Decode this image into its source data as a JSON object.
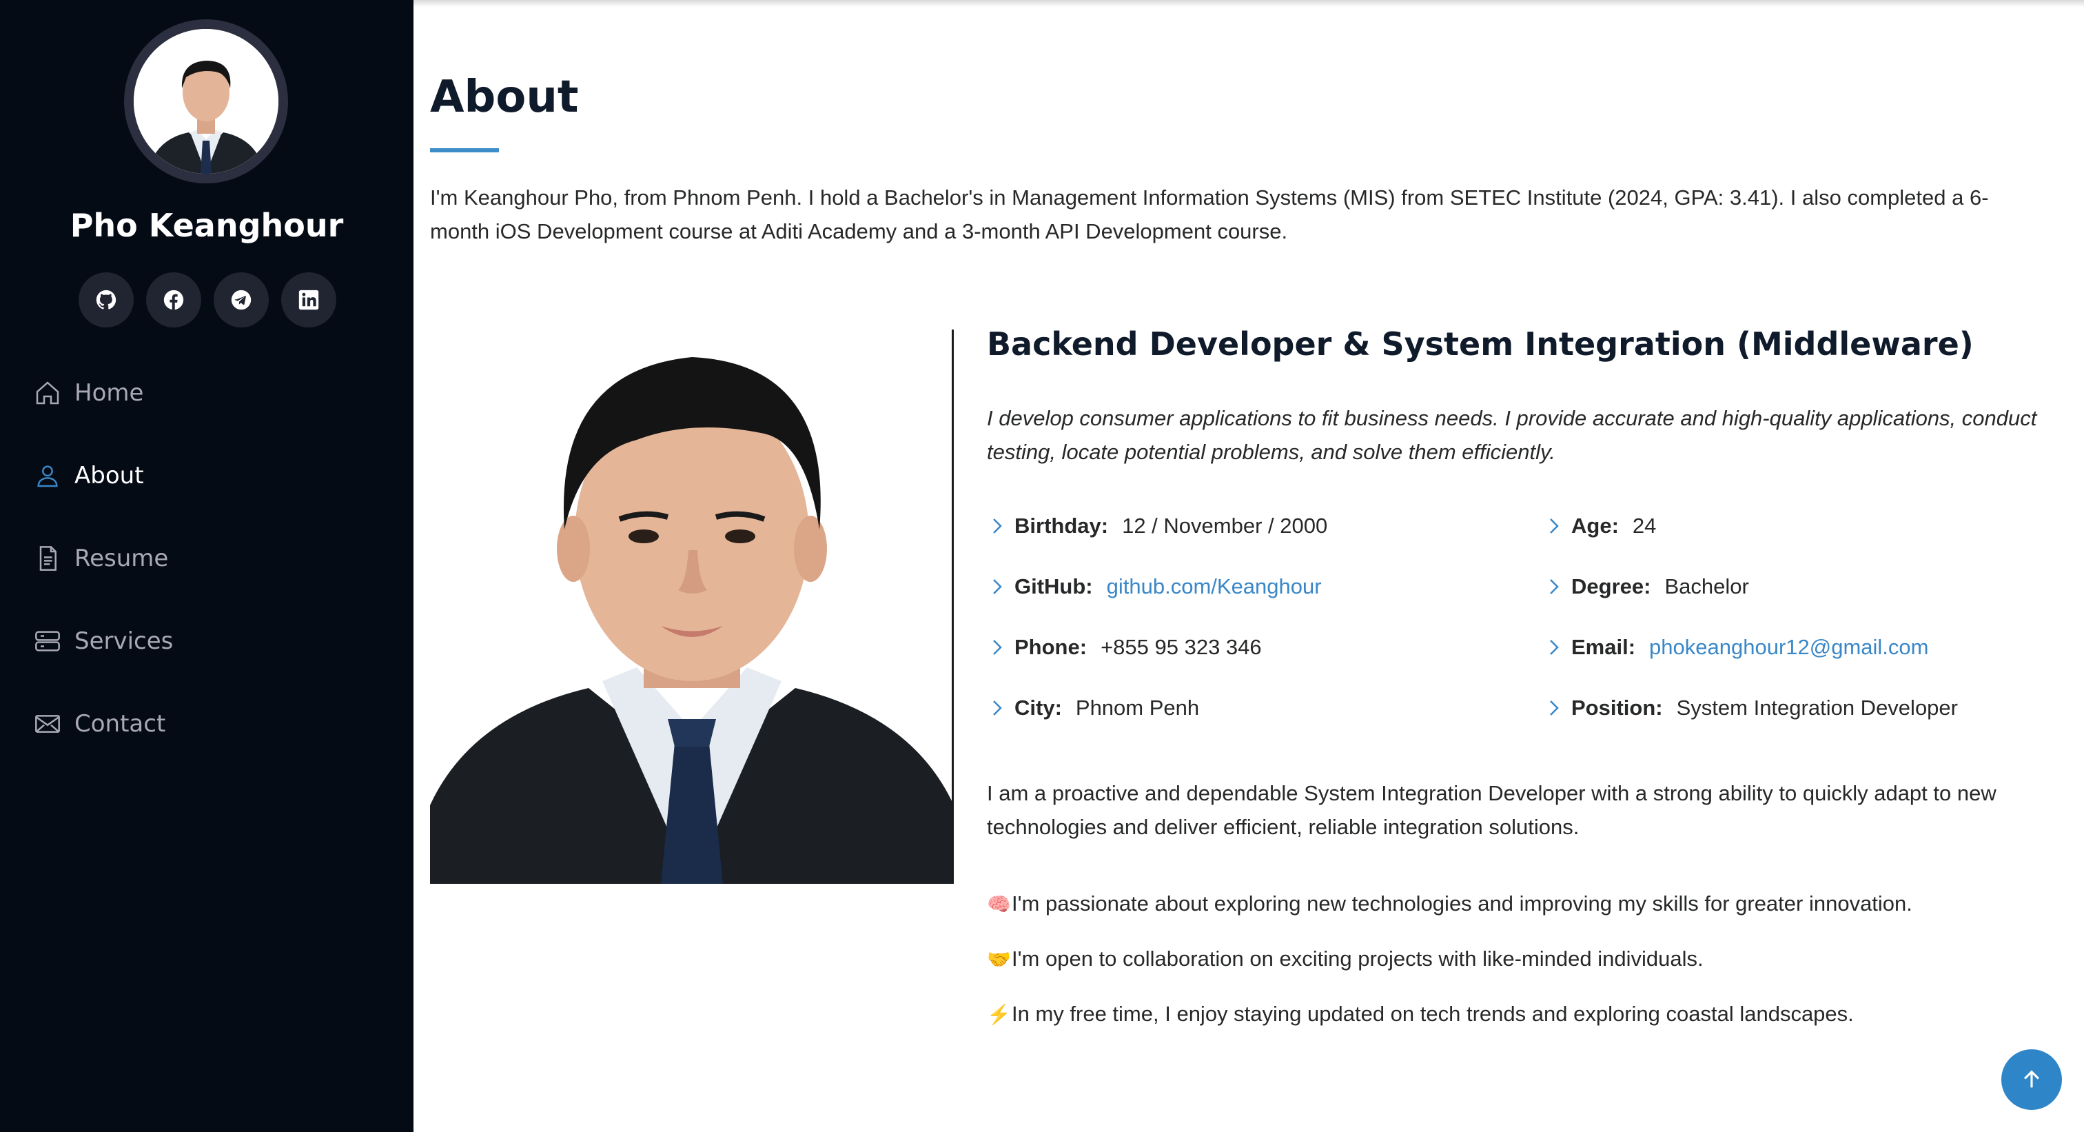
{
  "sidebar": {
    "name": "Pho Keanghour",
    "social": [
      "github-icon",
      "facebook-icon",
      "telegram-icon",
      "linkedin-icon"
    ],
    "nav": [
      {
        "label": "Home",
        "icon": "home-icon"
      },
      {
        "label": "About",
        "icon": "person-icon",
        "active": true
      },
      {
        "label": "Resume",
        "icon": "file-icon"
      },
      {
        "label": "Services",
        "icon": "server-icon"
      },
      {
        "label": "Contact",
        "icon": "envelope-icon"
      }
    ]
  },
  "about": {
    "title": "About",
    "intro": "I'm Keanghour Pho, from Phnom Penh. I hold a Bachelor's in Management Information Systems (MIS) from SETEC Institute (2024, GPA: 3.41). I also completed a 6-month iOS Development course at Aditi Academy and a 3-month API Development course.",
    "job_title": "Backend Developer & System Integration (Middleware)",
    "job_desc": "I develop consumer applications to fit business needs. I provide accurate and high-quality applications, conduct testing, locate potential problems, and solve them efficiently.",
    "info_left": [
      {
        "key": "Birthday:",
        "value": "12 / November / 2000"
      },
      {
        "key": "GitHub:",
        "value": "github.com/Keanghour"
      },
      {
        "key": "Phone:",
        "value": "+855 95 323 346"
      },
      {
        "key": "City:",
        "value": "Phnom Penh"
      }
    ],
    "info_right": [
      {
        "key": "Age:",
        "value": "24"
      },
      {
        "key": "Degree:",
        "value": "Bachelor"
      },
      {
        "key": "Email:",
        "value": "phokeanghour12@gmail.com"
      },
      {
        "key": "Position:",
        "value": "System Integration Developer"
      }
    ],
    "summary": "I am a proactive and dependable System Integration Developer with a strong ability to quickly adapt to new technologies and deliver efficient, reliable integration solutions.",
    "bullets": [
      {
        "emoji": "🧠",
        "text": "I'm passionate about exploring new technologies and improving my skills for greater innovation."
      },
      {
        "emoji": "🤝",
        "text": "I'm open to collaboration on exciting projects with like-minded individuals."
      },
      {
        "emoji": "⚡",
        "text": "In my free time, I enjoy staying updated on tech trends and exploring coastal landscapes."
      }
    ]
  },
  "colors": {
    "sidebar_bg": "#040b14",
    "accent": "#3a87c8",
    "social_bg": "#212431"
  }
}
